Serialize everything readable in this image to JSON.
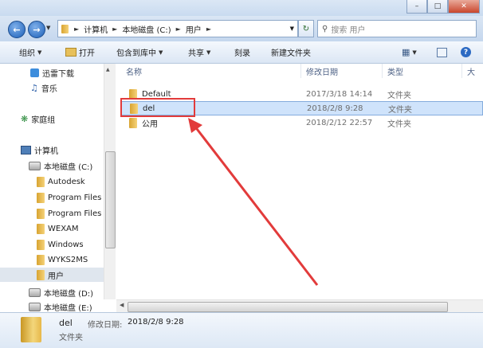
{
  "address": {
    "crumbs": [
      "计算机",
      "本地磁盘 (C:)",
      "用户"
    ],
    "search_placeholder": "搜索 用户"
  },
  "toolbar": {
    "organize": "组织",
    "open": "打开",
    "include_in_library": "包含到库中",
    "share": "共享",
    "burn": "刻录",
    "new_folder": "新建文件夹"
  },
  "sidebar": {
    "xunlei": "迅雷下载",
    "music": "音乐",
    "homegroup": "家庭组",
    "computer": "计算机",
    "drive_c": "本地磁盘 (C:)",
    "folders": [
      "Autodesk",
      "Program Files",
      "Program Files",
      "WEXAM",
      "Windows",
      "WYKS2MS",
      "用户"
    ],
    "drive_d": "本地磁盘 (D:)",
    "drive_e": "本地磁盘 (E:)"
  },
  "columns": {
    "name": "名称",
    "modified": "修改日期",
    "type": "类型",
    "size": "大"
  },
  "files": [
    {
      "name": "Default",
      "date": "2017/3/18 14:14",
      "type": "文件夹"
    },
    {
      "name": "del",
      "date": "2018/2/8 9:28",
      "type": "文件夹"
    },
    {
      "name": "公用",
      "date": "2018/2/12 22:57",
      "type": "文件夹"
    }
  ],
  "details": {
    "name": "del",
    "modified_label": "修改日期:",
    "modified_value": "2018/2/8 9:28",
    "type": "文件夹"
  },
  "colors": {
    "annotation": "#e23b3b",
    "selection": "#cfe3fb"
  }
}
